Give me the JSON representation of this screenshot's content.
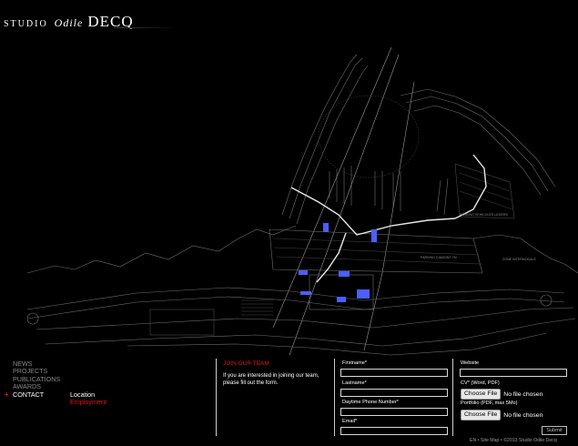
{
  "logo": {
    "studio": "STUDIO",
    "odile": "Odile",
    "decq": "DECQ"
  },
  "nav": [
    "NEWS",
    "PROJECTS",
    "PUBLICATIONS",
    "AWARDS",
    "CONTACT"
  ],
  "nav_active_marker": "+",
  "subnav": [
    "Location",
    "Employment"
  ],
  "join": {
    "title": "JOIN OUR TEAM",
    "text": "If you are interested in joining our team, please fill out the form."
  },
  "form": {
    "firstname": "Firstname*",
    "lastname": "Lastname*",
    "phone": "Daytime Phone Number*",
    "email": "Email*",
    "website": "Website",
    "cv": "CV* (Word, PDF)",
    "portfolio": "Portfolio (PDF, max 5Mo)",
    "file_button": "Choose File",
    "file_status": "No file chosen",
    "submit": "Submit"
  },
  "map_labels": {
    "parking_a": "PARKING VEHICULES LEGERS",
    "parking_b": "PARKING CAMIONS 7M",
    "zone": "ZONE INTERMODALE"
  },
  "footer": {
    "lang": "EN",
    "sep": " • ",
    "sitemap": "Site Map",
    "copyright": "©2013 Studio Odile Decq"
  },
  "colors": {
    "accent": "#e0161b",
    "background": "#000000",
    "muted": "#8a8a8a"
  }
}
